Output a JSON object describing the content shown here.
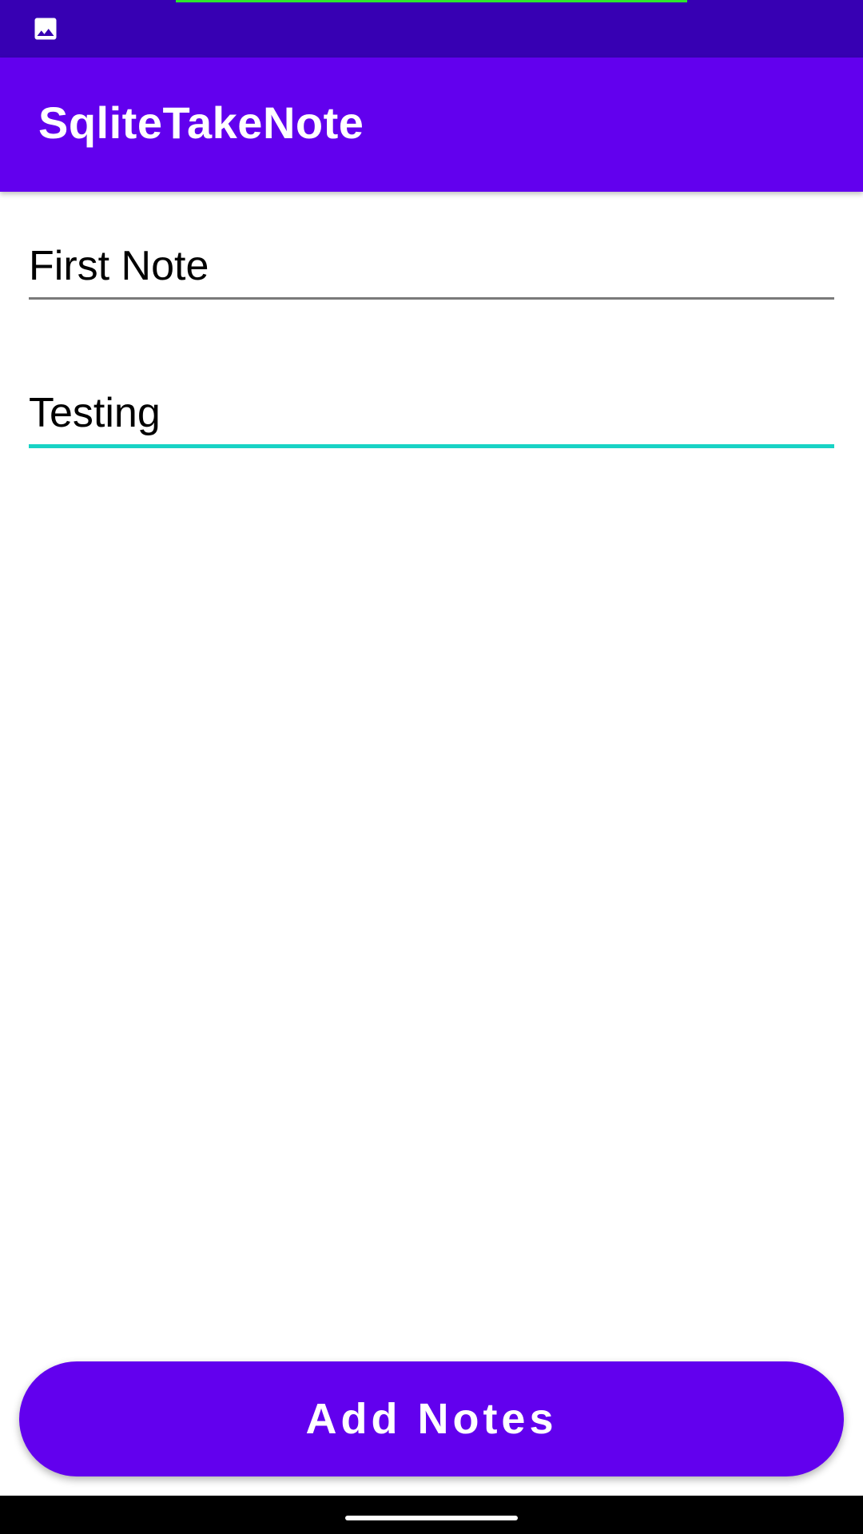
{
  "status_bar": {
    "icon": "image-icon",
    "background": "#3700b3",
    "progress_line_color": "#2ee52e"
  },
  "app_bar": {
    "title": "SqliteTakeNote",
    "background": "#6200ee"
  },
  "form": {
    "title_field": {
      "value": "First Note"
    },
    "body_field": {
      "value": "Testing"
    },
    "accent_color": "#18d3c5"
  },
  "add_button": {
    "label": "Add Notes",
    "background": "#6200ee"
  }
}
